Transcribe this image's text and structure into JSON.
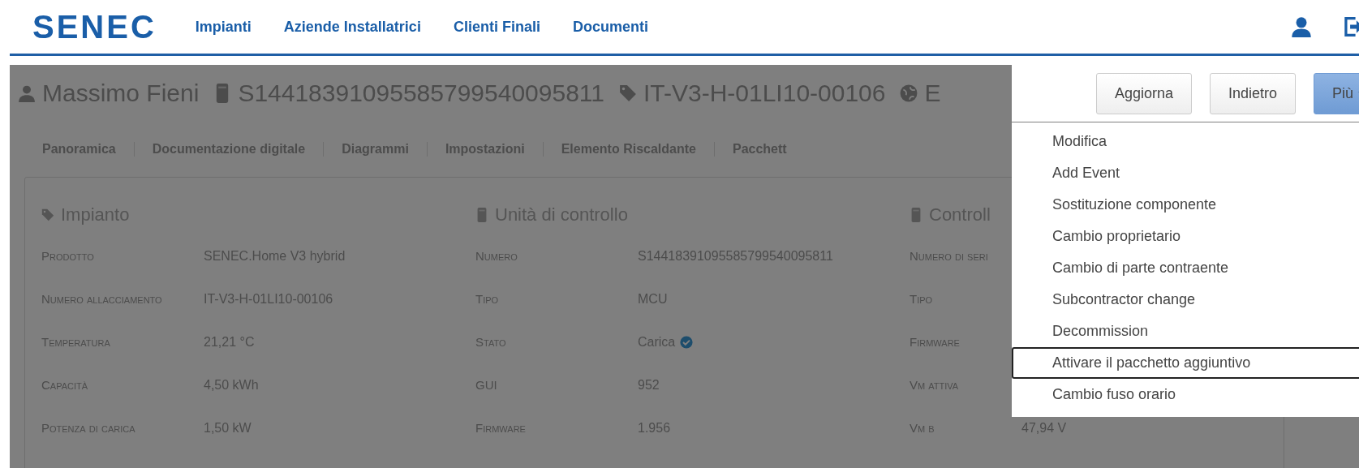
{
  "nav": {
    "logo": "SENEC",
    "links": [
      "Impianti",
      "Aziende Installatrici",
      "Clienti Finali",
      "Documenti"
    ]
  },
  "header": {
    "items": [
      {
        "kind": "person",
        "text": "Massimo Fieni"
      },
      {
        "kind": "device",
        "text": "S14418391095585799540095811"
      },
      {
        "kind": "tag",
        "text": "IT-V3-H-01LI10-00106"
      },
      {
        "kind": "globe",
        "text": "E"
      }
    ]
  },
  "buttons": [
    {
      "kind": "default",
      "label": "Aggiorna"
    },
    {
      "kind": "default",
      "label": "Indietro"
    },
    {
      "kind": "dropdown",
      "label": "Più"
    }
  ],
  "menu": {
    "items": [
      {
        "label": "Modifica",
        "selected": false
      },
      {
        "label": "Add Event",
        "selected": false
      },
      {
        "label": "Sostituzione componente",
        "selected": false
      },
      {
        "label": "Cambio proprietario",
        "selected": false
      },
      {
        "label": "Cambio di parte contraente",
        "selected": false
      },
      {
        "label": "Subcontractor change",
        "selected": false
      },
      {
        "label": "Decommission",
        "selected": false
      },
      {
        "label": "Attivare il pacchetto aggiuntivo",
        "selected": true
      },
      {
        "label": "Cambio fuso orario",
        "selected": false
      }
    ]
  },
  "tabs": [
    "Panoramica",
    "Documentazione digitale",
    "Diagrammi",
    "Impostazioni",
    "Elemento Riscaldante",
    "Pacchett"
  ],
  "panels": [
    {
      "kind": "tag",
      "title": "Impianto",
      "rows": [
        {
          "label": "Prodotto",
          "value": "SENEC.Home V3 hybrid"
        },
        {
          "label": "Numero allacciamento",
          "value": "IT-V3-H-01LI10-00106"
        },
        {
          "label": "Temperatura",
          "value": "21,21 °C"
        },
        {
          "label": "Capacità",
          "value": "4,50 kWh"
        },
        {
          "label": "Potenza di carica",
          "value": "1,50 kW"
        }
      ]
    },
    {
      "kind": "device",
      "title": "Unità di controllo",
      "rows": [
        {
          "label": "Numero",
          "value": "S14418391095585799540095811"
        },
        {
          "label": "Tipo",
          "value": "MCU"
        },
        {
          "label": "Stato",
          "value": "Carica",
          "kind": "check"
        },
        {
          "label": "GUI",
          "value": "952"
        },
        {
          "label": "Firmware",
          "value": "1.956"
        }
      ]
    },
    {
      "kind": "device",
      "title": "Controll",
      "rows": [
        {
          "label": "Numero di seri"
        },
        {
          "label": "Tipo"
        },
        {
          "label": "Firmware"
        },
        {
          "label": "Vm attiva"
        },
        {
          "label": "Vm b",
          "value": "47,94 V"
        }
      ]
    }
  ]
}
